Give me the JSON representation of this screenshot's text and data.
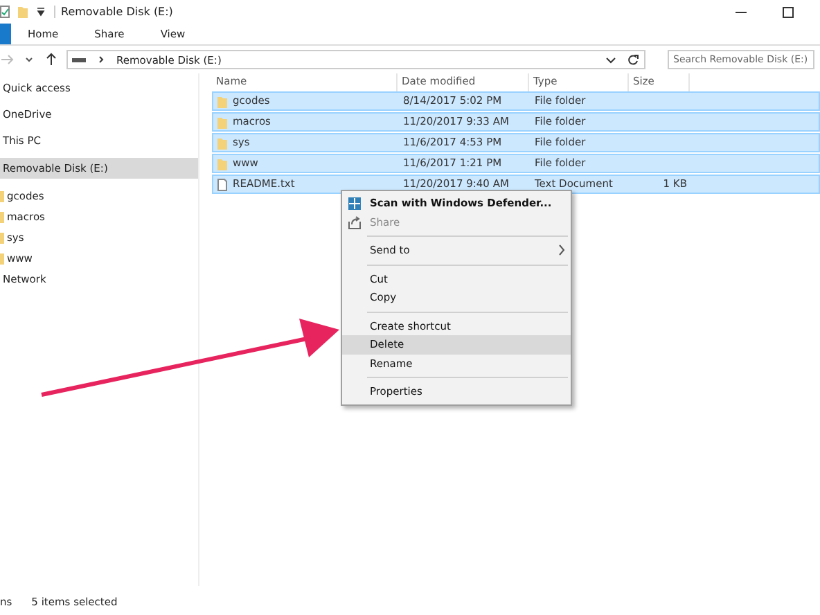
{
  "window": {
    "title": "Removable Disk (E:)"
  },
  "ribbon_tabs": [
    {
      "label": "Home",
      "selected": false
    },
    {
      "label": "Share",
      "selected": false
    },
    {
      "label": "View",
      "selected": false
    }
  ],
  "address": {
    "path": "Removable Disk (E:)",
    "search_placeholder": "Search Removable Disk (E:)"
  },
  "sidebar": {
    "items": [
      {
        "label": "Quick access",
        "selected": false
      },
      {
        "label": "OneDrive",
        "selected": false
      },
      {
        "label": "This PC",
        "selected": false
      },
      {
        "label": "Removable Disk (E:)",
        "selected": true,
        "children": [
          {
            "label": "gcodes",
            "selected": false
          },
          {
            "label": "macros",
            "selected": false
          },
          {
            "label": "sys",
            "selected": false
          },
          {
            "label": "www",
            "selected": false
          }
        ]
      },
      {
        "label": "Network",
        "selected": false
      }
    ]
  },
  "table": {
    "columns": [
      "Name",
      "Date modified",
      "Type",
      "Size"
    ],
    "rows": [
      {
        "kind": "folder",
        "name": "gcodes",
        "date": "8/14/2017 5:02 PM",
        "type": "File folder",
        "selected": true
      },
      {
        "kind": "folder",
        "name": "macros",
        "date": "11/20/2017 9:33 AM",
        "type": "File folder",
        "selected": true
      },
      {
        "kind": "folder",
        "name": "sys",
        "date": "11/6/2017 4:53 PM",
        "type": "File folder",
        "selected": true
      },
      {
        "kind": "folder",
        "name": "www",
        "date": "11/6/2017 1:21 PM",
        "type": "File folder",
        "selected": true
      },
      {
        "kind": "file",
        "name": "README.txt",
        "date": "11/20/2017 9:40 AM",
        "type": "Text Document",
        "size": "1 KB",
        "selected": true
      }
    ]
  },
  "context_menu": [
    {
      "kind": "item",
      "label": "Scan with Windows Defender...",
      "bold": true,
      "disabled": false,
      "highlighted": false
    },
    {
      "kind": "item",
      "label": "Share",
      "bold": false,
      "disabled": true,
      "highlighted": false
    },
    {
      "kind": "separator"
    },
    {
      "kind": "item",
      "label": "Send to",
      "submenu": true,
      "bold": false,
      "disabled": false,
      "highlighted": false
    },
    {
      "kind": "separator"
    },
    {
      "kind": "item",
      "label": "Cut",
      "bold": false,
      "disabled": false,
      "highlighted": false
    },
    {
      "kind": "item",
      "label": "Copy",
      "bold": false,
      "disabled": false,
      "highlighted": false
    },
    {
      "kind": "separator"
    },
    {
      "kind": "item",
      "label": "Create shortcut",
      "bold": false,
      "disabled": false,
      "highlighted": false
    },
    {
      "kind": "item",
      "label": "Delete",
      "bold": false,
      "disabled": false,
      "highlighted": true
    },
    {
      "kind": "item",
      "label": "Rename",
      "bold": false,
      "disabled": false,
      "highlighted": false
    },
    {
      "kind": "separator"
    },
    {
      "kind": "item",
      "label": "Properties",
      "bold": false,
      "disabled": false,
      "highlighted": false
    }
  ],
  "status_bar": [
    "ns",
    "5 items selected"
  ]
}
